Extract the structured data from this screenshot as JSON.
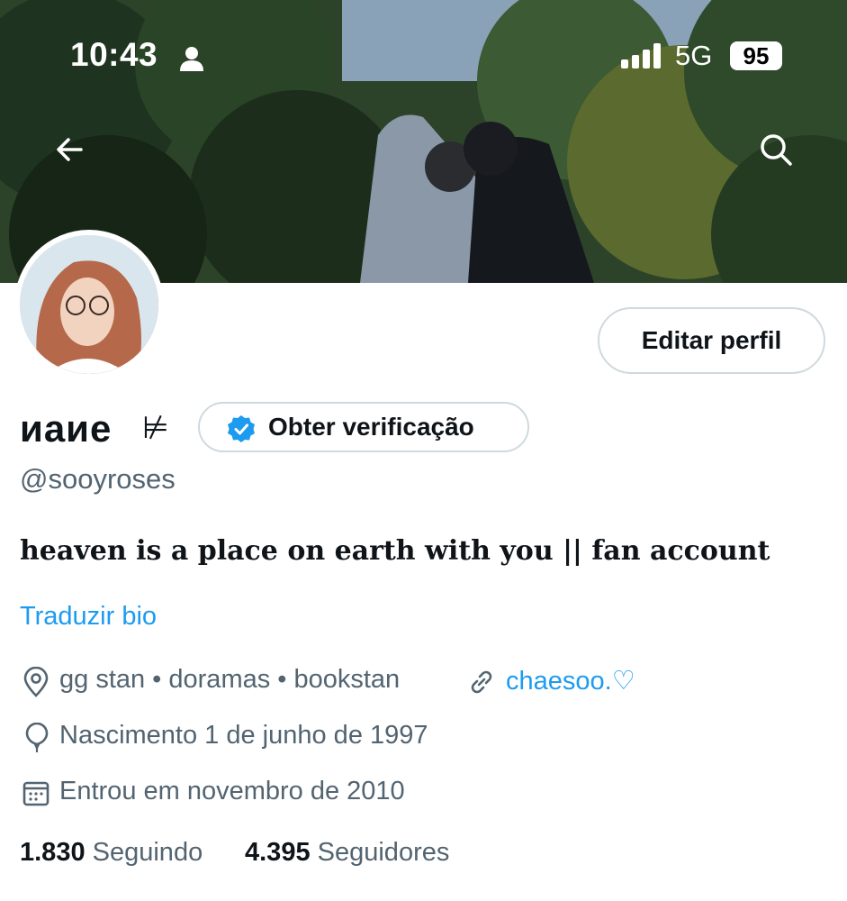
{
  "status_bar": {
    "time": "10:43",
    "network": "5G",
    "battery": "95"
  },
  "header": {
    "back_icon": "arrow-left-icon",
    "search_icon": "search-icon"
  },
  "profile": {
    "edit_label": "Editar perfil",
    "display_name": "иаие",
    "name_symbol": "⊭",
    "verify_label": "Obter verificação",
    "handle": "@sooyroses",
    "bio": "heaven is a place on earth with you || fan account",
    "translate_label": "Traduzir bio",
    "location": "gg stan • doramas • bookstan",
    "website": "chaesoo.♡",
    "birth": "Nascimento 1 de junho de 1997",
    "joined": "Entrou em novembro de 2010",
    "following_count": "1.830",
    "following_label": "Seguindo",
    "followers_count": "4.395",
    "followers_label": "Seguidores"
  },
  "colors": {
    "accent": "#1d9bf0",
    "secondary_text": "#536471",
    "border": "#cfd9de"
  }
}
